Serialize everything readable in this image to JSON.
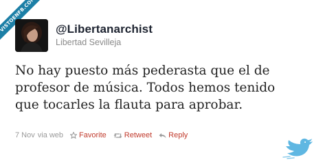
{
  "site": {
    "watermark": "VISTOENFB.COM"
  },
  "tweet": {
    "handle": "@Libertanarchist",
    "display_name": "Libertad Sevilleja",
    "text_lines": [
      "No hay puesto más pederasta que el de",
      "profesor de música. Todos hemos tenido",
      "que tocarles la flauta para aprobar."
    ],
    "timestamp": "7 Nov",
    "source": "via web",
    "actions": {
      "favorite": "Favorite",
      "retweet": "Retweet",
      "reply": "Reply"
    }
  },
  "colors": {
    "ribbon": "#1c7fa6",
    "action": "#c0392b",
    "meta": "#999999",
    "bird": "#5fb7e2"
  },
  "icons": [
    "star-icon",
    "retweet-icon",
    "reply-icon",
    "twitter-bird-icon"
  ]
}
